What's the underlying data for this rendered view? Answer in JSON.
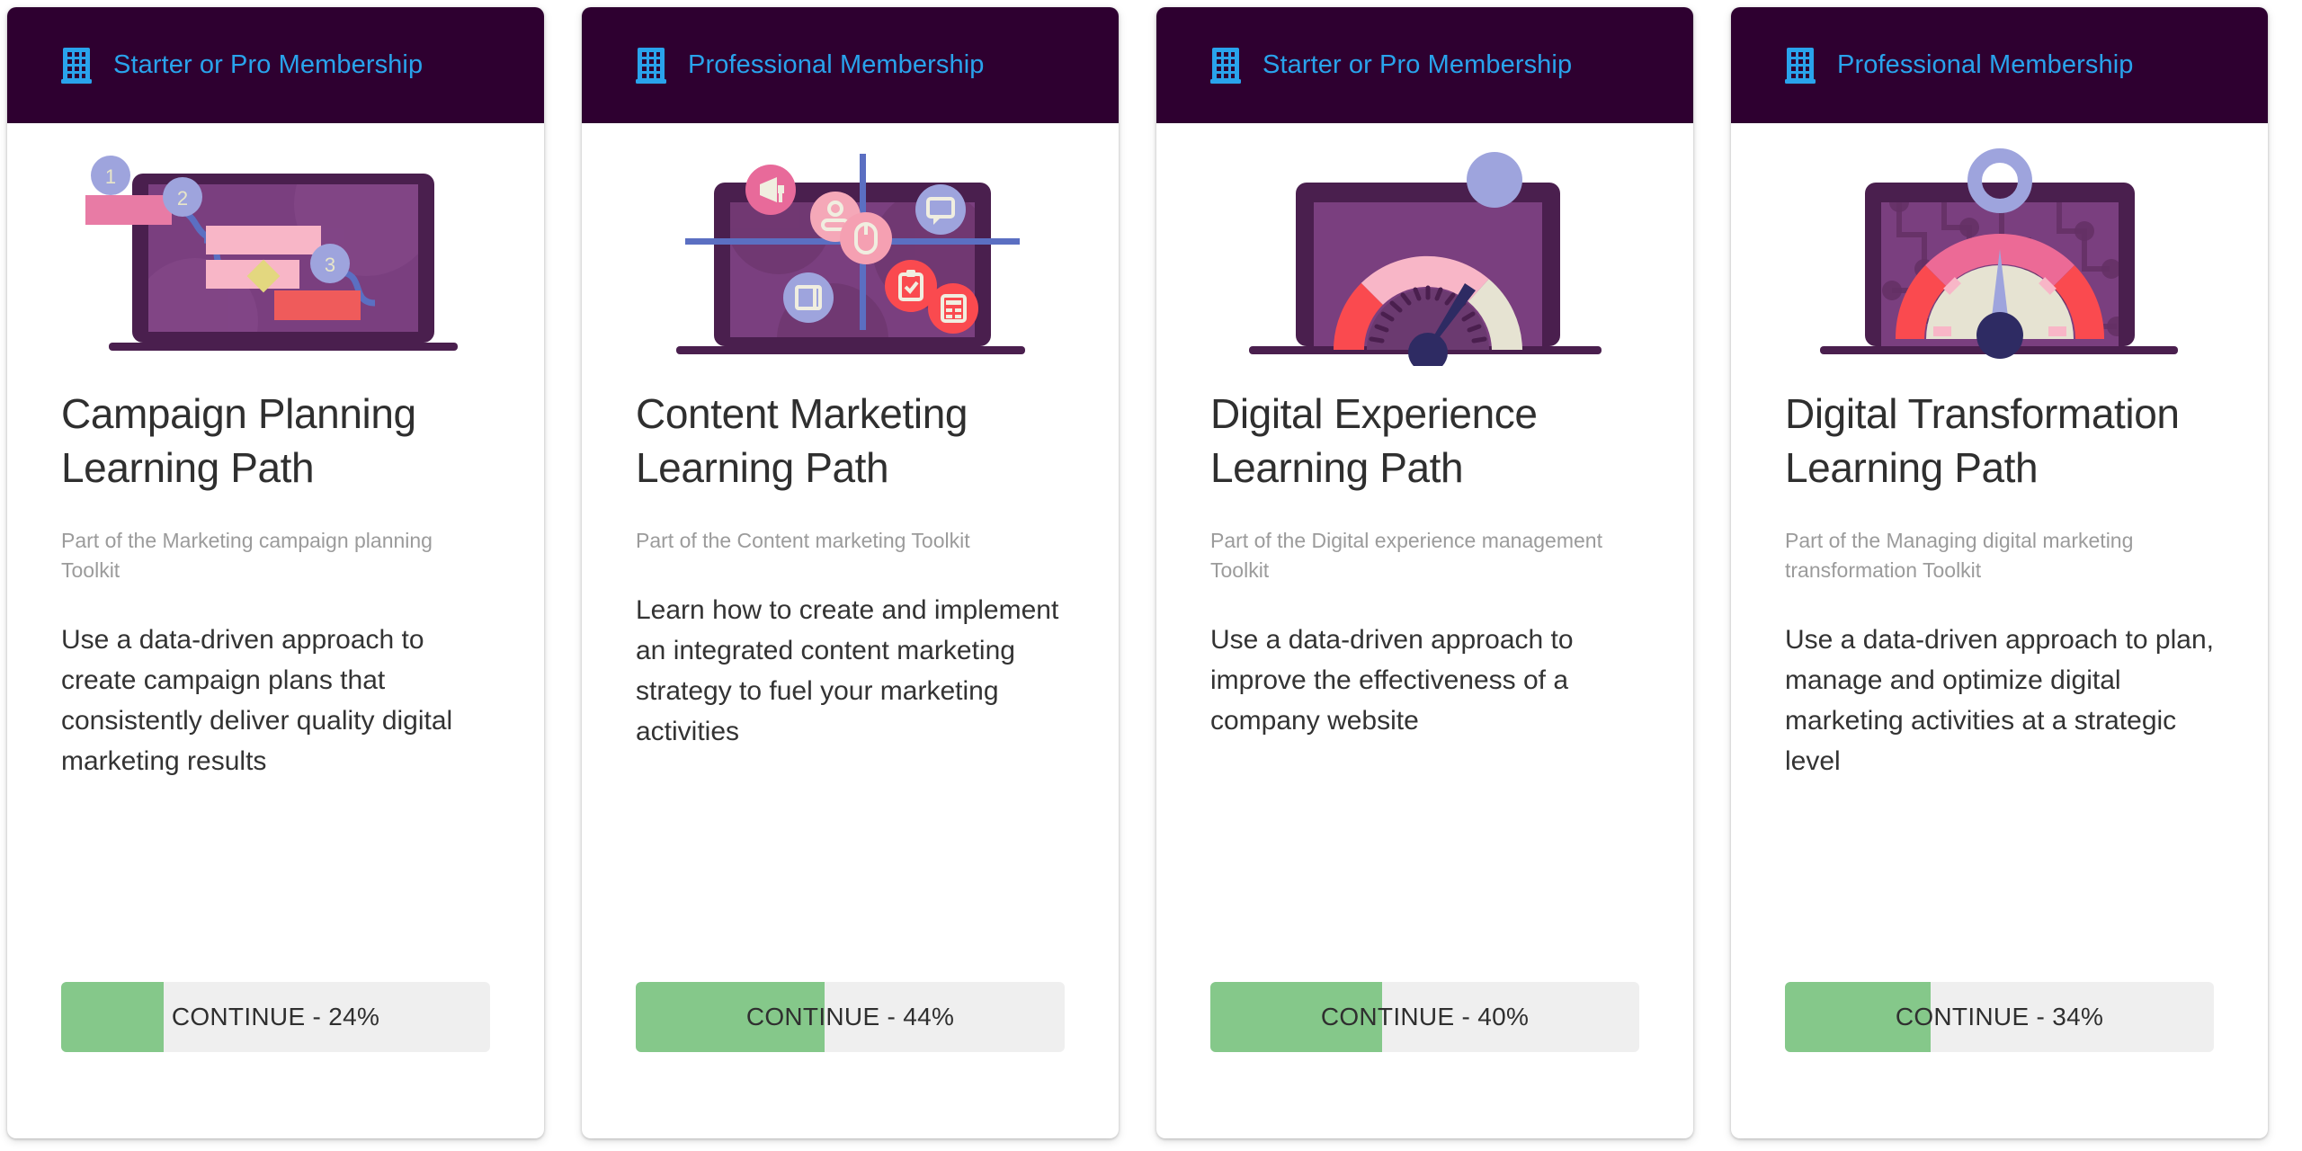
{
  "theme": {
    "header_bg": "#2e0030",
    "header_text": "#29a3ec",
    "progress_fill": "#85c88a",
    "progress_track": "#efefef",
    "title_color": "#2f2f2f",
    "subtitle_color": "#9b9b9b",
    "card_bg": "#ffffff",
    "page_bg": "#ffffff"
  },
  "cards": [
    {
      "membership_label": "Starter or Pro Membership",
      "membership_icon": "building-icon",
      "illustration": "campaign-planning-illustration",
      "title": "Campaign Planning Learning Path",
      "subtitle": "Part of the Marketing campaign planning Toolkit",
      "description": "Use a data-driven approach to create campaign plans that consistently deliver quality digital marketing results",
      "button_label": "CONTINUE - 24%",
      "progress_percent": 24
    },
    {
      "membership_label": "Professional Membership",
      "membership_icon": "building-icon",
      "illustration": "content-marketing-illustration",
      "title": "Content Marketing Learning Path",
      "subtitle": "Part of the Content marketing Toolkit",
      "description": "Learn how to create and implement an integrated content marketing strategy to fuel your marketing activities",
      "button_label": "CONTINUE - 44%",
      "progress_percent": 44
    },
    {
      "membership_label": "Starter or Pro Membership",
      "membership_icon": "building-icon",
      "illustration": "digital-experience-gauge-illustration",
      "title": "Digital Experience Learning Path",
      "subtitle": "Part of the Digital experience management Toolkit",
      "description": "Use a data-driven approach to improve the effectiveness of a company website",
      "button_label": "CONTINUE - 40%",
      "progress_percent": 40
    },
    {
      "membership_label": "Professional Membership",
      "membership_icon": "building-icon",
      "illustration": "digital-transformation-gauge-illustration",
      "title": "Digital Transformation Learning Path",
      "subtitle": "Part of the Managing digital marketing transformation Toolkit",
      "description": "Use a data-driven approach to plan, manage and optimize digital marketing activities at a strategic level",
      "button_label": "CONTINUE - 34%",
      "progress_percent": 34
    }
  ]
}
